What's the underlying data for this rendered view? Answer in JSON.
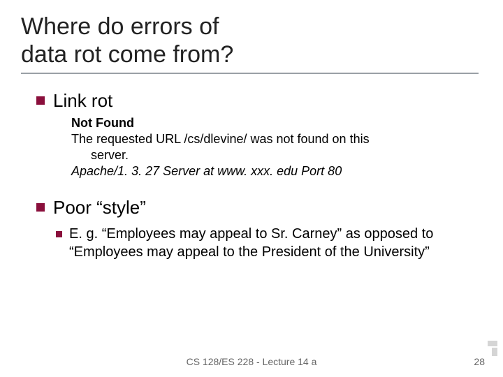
{
  "title_line1": "Where do errors of",
  "title_line2": "data rot come from?",
  "bullets": {
    "link_rot": {
      "label": "Link rot",
      "not_found": "Not Found",
      "msg_line1": "The requested URL /cs/dlevine/ was not found on this",
      "msg_line2": "server.",
      "server_line": "Apache/1. 3. 27 Server at www. xxx. edu Port 80"
    },
    "poor_style": {
      "label": "Poor “style”",
      "example": "E. g. “Employees may appeal to Sr. Carney” as opposed to “Employees may appeal to the President of the University”"
    }
  },
  "footer": {
    "center": "CS 128/ES 228 - Lecture 14 a",
    "page": "28"
  }
}
